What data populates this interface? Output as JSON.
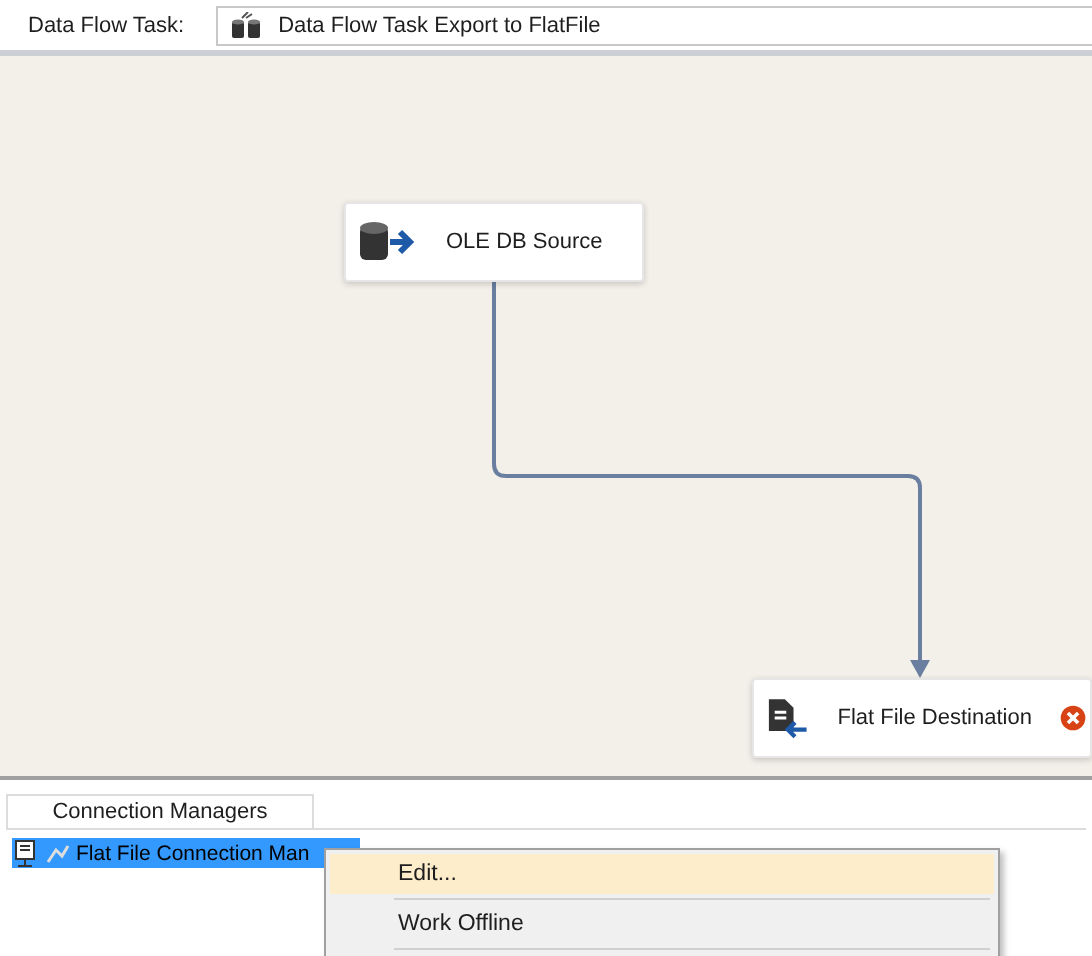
{
  "header": {
    "label": "Data Flow Task:",
    "task": "Data Flow Task Export to FlatFile"
  },
  "nodes": [
    {
      "label": "OLE DB Source",
      "kind": "source",
      "error": false
    },
    {
      "label": "Flat File Destination",
      "kind": "destination",
      "error": true
    }
  ],
  "connection_managers": {
    "tab": "Connection Managers",
    "items": [
      {
        "label": "Flat File Connection Man",
        "selected": true
      }
    ]
  },
  "context_menu": {
    "items": [
      {
        "label": "Edit...",
        "selected": true
      },
      {
        "label": "Work Offline",
        "selected": false
      }
    ]
  }
}
